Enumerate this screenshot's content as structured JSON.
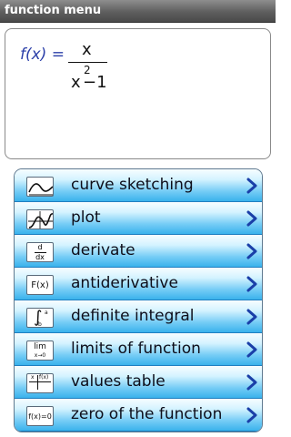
{
  "app": {
    "title": "function menu"
  },
  "formula": {
    "lhs": "f(x) =",
    "numerator": "x",
    "denominator_base": "x",
    "denominator_exponent": "2",
    "denominator_rest": "−1"
  },
  "menu": {
    "items": [
      {
        "label": "curve sketching",
        "icon": "curve-sketching-icon"
      },
      {
        "label": "plot",
        "icon": "plot-icon"
      },
      {
        "label": "derivate",
        "icon": "derivative-icon",
        "icon_text_top": "d",
        "icon_text_bottom": "dx"
      },
      {
        "label": "antiderivative",
        "icon": "antiderivative-icon",
        "icon_text": "F(x)"
      },
      {
        "label": "definite integral",
        "icon": "definite-integral-icon",
        "icon_text_upper": "a",
        "icon_text_lower": "b"
      },
      {
        "label": "limits of function",
        "icon": "limit-icon",
        "icon_text_top": "lim",
        "icon_text_bottom": "x→0"
      },
      {
        "label": "values table",
        "icon": "values-table-icon",
        "icon_text_left": "x",
        "icon_text_right": "f(x)"
      },
      {
        "label": "zero of the function",
        "icon": "zero-icon",
        "icon_text": "f(x)=0"
      }
    ],
    "chevron_icon": "chevron-right-icon"
  },
  "colors": {
    "title_bar": "#5e5e5e",
    "formula_lhs": "#2a3ea8",
    "menu_gradient_top": "#f7fdff",
    "menu_gradient_bottom": "#3ab2ec",
    "chevron": "#1a3fa8"
  }
}
